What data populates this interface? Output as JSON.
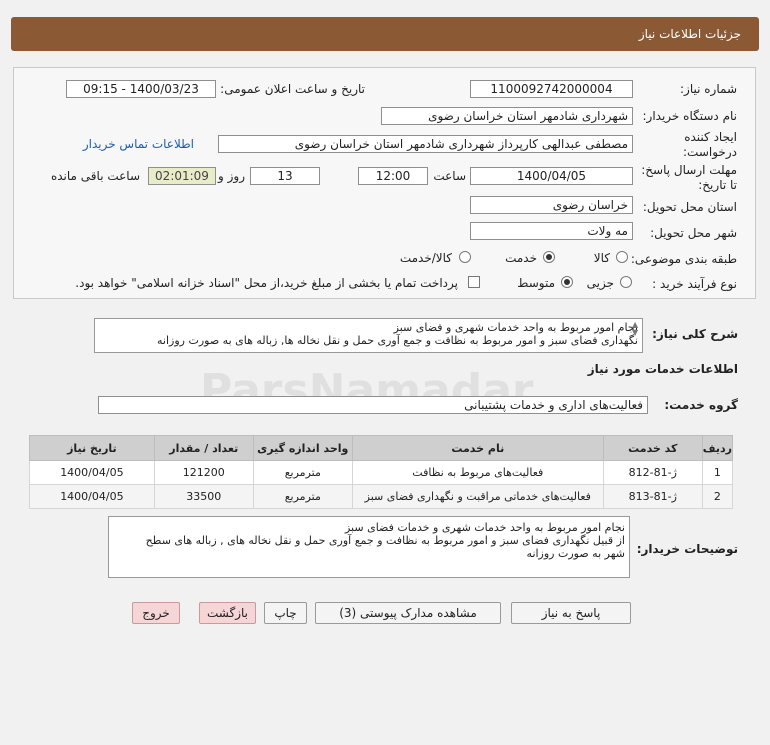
{
  "header": {
    "title": "جزئیات اطلاعات نیاز"
  },
  "form": {
    "need_number_label": "شماره نیاز:",
    "need_number": "1100092742000004",
    "announce_label": "تاریخ و ساعت اعلان عمومی:",
    "announce_value": "1400/03/23 - 09:15",
    "buyer_org_label": "نام دستگاه خریدار:",
    "buyer_org": "شهرداری شادمهر استان خراسان رضوی",
    "creator_label_1": "ایجاد کننده",
    "creator_label_2": "درخواست:",
    "creator": "مصطفی عبدالهی کارپرداز شهرداری شادمهر استان خراسان رضوی",
    "contact_link": "اطلاعات تماس خریدار",
    "deadline_label_1": "مهلت ارسال پاسخ:",
    "deadline_label_2": "تا تاریخ:",
    "deadline_date": "1400/04/05",
    "time_label": "ساعت",
    "deadline_time": "12:00",
    "days_count": "13",
    "days_label": "روز و",
    "remaining_time": "02:01:09",
    "remaining_label": "ساعت باقی مانده",
    "province_label": "استان محل تحویل:",
    "province": "خراسان رضوی",
    "city_label": "شهر محل تحویل:",
    "city": "مه ولات",
    "category_label": "طبقه بندی موضوعی:",
    "category_options": [
      "کالا",
      "خدمت",
      "کالا/خدمت"
    ],
    "category_selected": "خدمت",
    "process_label": "نوع فرآیند خرید :",
    "process_options": [
      "جزیی",
      "متوسط"
    ],
    "process_selected": "متوسط",
    "payment_note": "پرداخت تمام یا بخشی از مبلغ خرید،از محل \"اسناد خزانه اسلامی\" خواهد بود."
  },
  "summary": {
    "label": "شرح کلی نیاز:",
    "line1": "نجام امور مربوط به واحد خدمات شهری و فضای سبز",
    "line2": "نگهداری فضای سبز و امور مربوط به نظافت  و جمع آوری حمل و نقل نخاله ها, زباله های  به صورت روزانه"
  },
  "services": {
    "section_title": "اطلاعات خدمات مورد نیاز",
    "group_label": "گروه خدمت:",
    "group_value": "فعالیت‌های اداری و خدمات پشتیبانی",
    "columns": [
      "ردیف",
      "کد خدمت",
      "نام خدمت",
      "واحد اندازه گیری",
      "تعداد / مقدار",
      "تاریخ نیاز"
    ],
    "rows": [
      [
        "1",
        "ژ-81-812",
        "فعالیت‌های مربوط به نظافت",
        "مترمربع",
        "121200",
        "1400/04/05"
      ],
      [
        "2",
        "ژ-81-813",
        "فعالیت‌های خدماتی مراقبت و نگهداری فضای سبز",
        "مترمربع",
        "33500",
        "1400/04/05"
      ]
    ]
  },
  "buyer_notes": {
    "label": "توضیحات خریدار:",
    "line1": "نجام امور مربوط به واحد خدمات شهری و خدمات فضای سبز",
    "line2": "از قبیل نگهداری فضای سبز و امور مربوط به نظافت  و جمع آوری حمل و نقل نخاله های , زباله های سطح",
    "line3": "شهر به صورت روزانه"
  },
  "buttons": {
    "reply": "پاسخ به نیاز",
    "attachments": "مشاهده مدارک پیوستی (3)",
    "print": "چاپ",
    "back": "بازگشت",
    "exit": "خروج"
  }
}
